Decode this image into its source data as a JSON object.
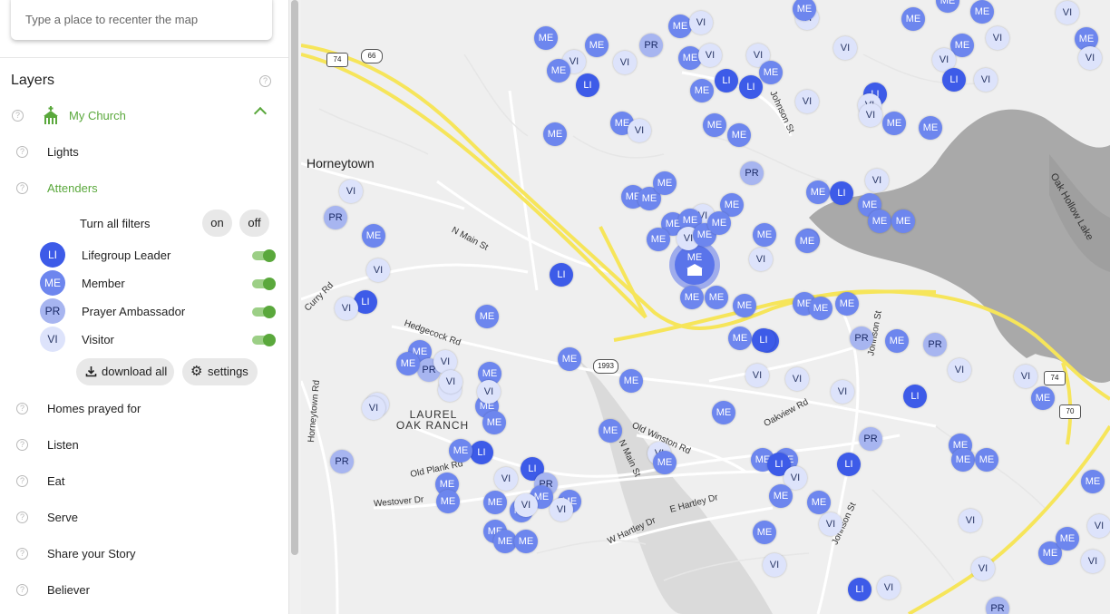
{
  "search": {
    "placeholder": "Type a place to recenter the map"
  },
  "layers": {
    "title": "Layers",
    "my_church": "My Church",
    "items_top": [
      "Lights",
      "Attenders"
    ],
    "filters": {
      "turn_all": "Turn all filters",
      "on": "on",
      "off": "off"
    },
    "legend": [
      {
        "code": "LI",
        "label": "Lifegroup Leader",
        "on": true
      },
      {
        "code": "ME",
        "label": "Member",
        "on": true
      },
      {
        "code": "PR",
        "label": "Prayer Ambassador",
        "on": true
      },
      {
        "code": "VI",
        "label": "Visitor",
        "on": true
      }
    ],
    "download_label": "download all",
    "settings_label": "settings",
    "items_bottom": [
      "Homes prayed for",
      "Listen",
      "Eat",
      "Serve",
      "Share your Story",
      "Believer"
    ]
  },
  "colors": {
    "accent": "#5aa83c",
    "LI": "#3d5be8",
    "ME": "#6d86ee",
    "PR": "#a7b5f0",
    "VI": "#dde3fb",
    "highway": "#f6e55a"
  },
  "map": {
    "places": [
      "Horneytown",
      "LAUREL",
      "OAK RANCH"
    ],
    "roads": [
      "N Main St",
      "Hedgecock Rd",
      "Curry Rd",
      "Horneytown Rd",
      "Old Plank Rd",
      "Westover Dr",
      "Old Winston Rd",
      "N Main St",
      "E Hartley Dr",
      "W Hartley Dr",
      "Oakview Rd",
      "Johnson St",
      "Johnson St",
      "Johnson St",
      "Oak Hollow Lake"
    ],
    "shields": [
      "74",
      "66",
      "1993",
      "74",
      "70"
    ],
    "church_badge": "ME"
  },
  "markers": [
    [
      "ME",
      270,
      42
    ],
    [
      "VI",
      301,
      68
    ],
    [
      "ME",
      284,
      78
    ],
    [
      "LI",
      316,
      94
    ],
    [
      "ME",
      326,
      50
    ],
    [
      "ME",
      354,
      136
    ],
    [
      "VI",
      357,
      69
    ],
    [
      "PR",
      386,
      50
    ],
    [
      "ME",
      418,
      29
    ],
    [
      "VI",
      441,
      25
    ],
    [
      "ME",
      429,
      64
    ],
    [
      "VI",
      451,
      61
    ],
    [
      "LI",
      469,
      89
    ],
    [
      "ME",
      442,
      100
    ],
    [
      "LI",
      496,
      96
    ],
    [
      "VI",
      504,
      61
    ],
    [
      "ME",
      518,
      80
    ],
    [
      "VI",
      558,
      112
    ],
    [
      "ME",
      456,
      138
    ],
    [
      "ME",
      483,
      149
    ],
    [
      "VI",
      373,
      144
    ],
    [
      "ME",
      280,
      148
    ],
    [
      "PR",
      497,
      191
    ],
    [
      "ME",
      366,
      217
    ],
    [
      "ME",
      384,
      219
    ],
    [
      "ME",
      401,
      202
    ],
    [
      "VI",
      443,
      238
    ],
    [
      "ME",
      475,
      226
    ],
    [
      "ME",
      410,
      247
    ],
    [
      "ME",
      429,
      243
    ],
    [
      "VI",
      427,
      263
    ],
    [
      "ME",
      445,
      259
    ],
    [
      "ME",
      461,
      246
    ],
    [
      "ME",
      394,
      264
    ],
    [
      "ME",
      511,
      259
    ],
    [
      "VI",
      507,
      286
    ],
    [
      "ME",
      559,
      265
    ],
    [
      "LI",
      287,
      303
    ],
    [
      "ME",
      431,
      328
    ],
    [
      "ME",
      458,
      328
    ],
    [
      "ME",
      489,
      337
    ],
    [
      "ME",
      484,
      373
    ],
    [
      "LI",
      514,
      376
    ],
    [
      "LI",
      510,
      375
    ],
    [
      "ME",
      555,
      335
    ],
    [
      "ME",
      573,
      340
    ],
    [
      "ME",
      602,
      335
    ],
    [
      "VI",
      503,
      414
    ],
    [
      "VI",
      547,
      418
    ],
    [
      "VI",
      597,
      432
    ],
    [
      "ME",
      466,
      455
    ],
    [
      "PR",
      628,
      484
    ],
    [
      "ME",
      509,
      507
    ],
    [
      "ME",
      535,
      507
    ],
    [
      "LI",
      527,
      512
    ],
    [
      "VI",
      545,
      527
    ],
    [
      "LI",
      604,
      512
    ],
    [
      "ME",
      529,
      547
    ],
    [
      "ME",
      571,
      554
    ],
    [
      "VI",
      584,
      578
    ],
    [
      "ME",
      511,
      587
    ],
    [
      "VI",
      522,
      623
    ],
    [
      "LI",
      616,
      650
    ],
    [
      "VI",
      648,
      648
    ],
    [
      "ME",
      296,
      396
    ],
    [
      "ME",
      364,
      420
    ],
    [
      "ME",
      341,
      475
    ],
    [
      "VI",
      395,
      500
    ],
    [
      "ME",
      401,
      510
    ],
    [
      "ME",
      570,
      212
    ],
    [
      "LI",
      596,
      213
    ],
    [
      "ME",
      627,
      226
    ],
    [
      "ME",
      638,
      244
    ],
    [
      "ME",
      664,
      244
    ],
    [
      "VI",
      635,
      199
    ],
    [
      "ME",
      558,
      266
    ],
    [
      "LI",
      633,
      104
    ],
    [
      "VI",
      627,
      116
    ],
    [
      "VI",
      628,
      127
    ],
    [
      "ME",
      654,
      136
    ],
    [
      "ME",
      694,
      141
    ],
    [
      "VI",
      600,
      53
    ],
    [
      "ME",
      675,
      21
    ],
    [
      "ME",
      729,
      50
    ],
    [
      "VI",
      709,
      66
    ],
    [
      "LI",
      720,
      88
    ],
    [
      "VI",
      755,
      88
    ],
    [
      "ME",
      751,
      13
    ],
    [
      "VI",
      768,
      42
    ],
    [
      "VI",
      845,
      14
    ],
    [
      "ME",
      866,
      43
    ],
    [
      "VI",
      870,
      64
    ],
    [
      "VI",
      558,
      20
    ],
    [
      "ME",
      555,
      10
    ],
    [
      "ME",
      713,
      1
    ],
    [
      "PR",
      618,
      373
    ],
    [
      "ME",
      657,
      376
    ],
    [
      "PR",
      699,
      380
    ],
    [
      "VI",
      726,
      408
    ],
    [
      "VI",
      799,
      415
    ],
    [
      "ME",
      818,
      439
    ],
    [
      "LI",
      677,
      437
    ],
    [
      "ME",
      727,
      491
    ],
    [
      "ME",
      730,
      507
    ],
    [
      "ME",
      756,
      507
    ],
    [
      "VI",
      738,
      574
    ],
    [
      "VI",
      752,
      627
    ],
    [
      "ME",
      826,
      610
    ],
    [
      "ME",
      845,
      594
    ],
    [
      "VI",
      873,
      619
    ],
    [
      "ME",
      873,
      531
    ],
    [
      "VI",
      880,
      580
    ],
    [
      "PR",
      768,
      671
    ],
    [
      "ME",
      205,
      448
    ],
    [
      "LI",
      199,
      499
    ],
    [
      "ME",
      176,
      497
    ],
    [
      "ME",
      161,
      534
    ],
    [
      "ME",
      162,
      553
    ],
    [
      "VI",
      226,
      528
    ],
    [
      "LI",
      255,
      517
    ],
    [
      "PR",
      270,
      534
    ],
    [
      "ME",
      265,
      548
    ],
    [
      "ME",
      296,
      553
    ],
    [
      "VI",
      287,
      562
    ],
    [
      "ME",
      243,
      563
    ],
    [
      "VI",
      248,
      557
    ],
    [
      "ME",
      214,
      554
    ],
    [
      "ME",
      214,
      586
    ],
    [
      "ME",
      225,
      597
    ],
    [
      "ME",
      248,
      597
    ],
    [
      "ME",
      208,
      412
    ],
    [
      "VI",
      207,
      432
    ],
    [
      "VI",
      164,
      430
    ],
    [
      "ME",
      213,
      466
    ],
    [
      "ME",
      131,
      388
    ],
    [
      "PR",
      141,
      408
    ],
    [
      "VI",
      159,
      399
    ],
    [
      "ME",
      118,
      401
    ],
    [
      "VI",
      165,
      421
    ],
    [
      "VI",
      84,
      446
    ],
    [
      "VI",
      80,
      450
    ],
    [
      "LI",
      71,
      333
    ],
    [
      "VI",
      50,
      340
    ],
    [
      "ME",
      80,
      260
    ],
    [
      "VI",
      85,
      298
    ],
    [
      "PR",
      38,
      240
    ],
    [
      "VI",
      55,
      211
    ],
    [
      "ME",
      205,
      349
    ],
    [
      "PR",
      45,
      509
    ]
  ]
}
